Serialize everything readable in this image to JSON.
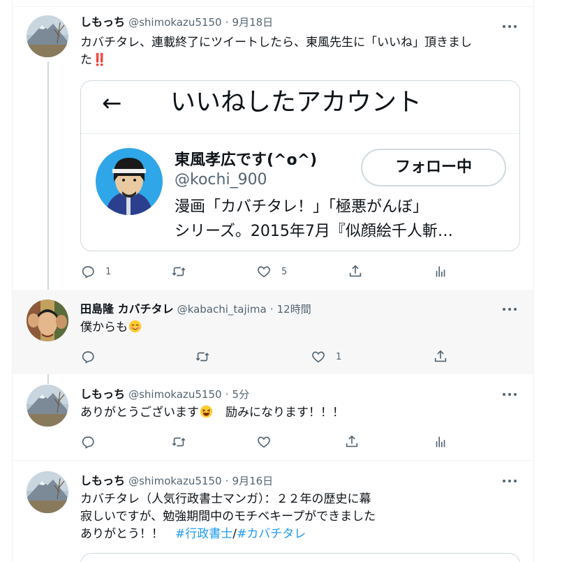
{
  "tweets": [
    {
      "name": "しもっち",
      "handle": "@shimokazu5150",
      "sep": "·",
      "time": "9月18日",
      "text": "カバチタレ、連載終了にツイートしたら、東風先生に「いいね」頂きまし",
      "text2": "た",
      "text_bangs": "‼️",
      "actions": {
        "reply": "1",
        "retweet": "",
        "like": "5"
      }
    },
    {
      "name": "田島隆 カバチタレ",
      "handle": "@kabachi_tajima",
      "sep": "·",
      "time": "12時間",
      "text": "僕からも",
      "actions": {
        "reply": "",
        "retweet": "",
        "like": "1"
      }
    },
    {
      "name": "しもっち",
      "handle": "@shimokazu5150",
      "sep": "·",
      "time": "5分",
      "text_a": "ありがとうございます",
      "text_b": "　励みになります！！！",
      "actions": {
        "reply": "",
        "retweet": "",
        "like": ""
      }
    },
    {
      "name": "しもっち",
      "handle": "@shimokazu5150",
      "sep": "·",
      "time": "9月16日",
      "line1": "カバチタレ（人気行政書士マンガ）：２２年の歴史に幕",
      "line2": "寂しいですが、勉強期間中のモチベキープができました",
      "line3": "ありがとう！！　",
      "tag1": "#行政書士",
      "slash": "/",
      "tag2": "#カバチタレ"
    }
  ],
  "card": {
    "back": "←",
    "title": "いいねしたアカウント",
    "name": "東風孝広です(^o^)",
    "handle": "@kochi_900",
    "bio1": "漫画「カバチタレ！」「極悪がんぼ」",
    "bio2": "シリーズ。2015年7月『似顔絵千人斬…",
    "follow": "フォロー中"
  },
  "colors": {
    "accent": "#1d9bf0",
    "text": "#0f1419",
    "muted": "#536471",
    "border": "#eff3f4",
    "highlight": "#f7f7f7"
  }
}
